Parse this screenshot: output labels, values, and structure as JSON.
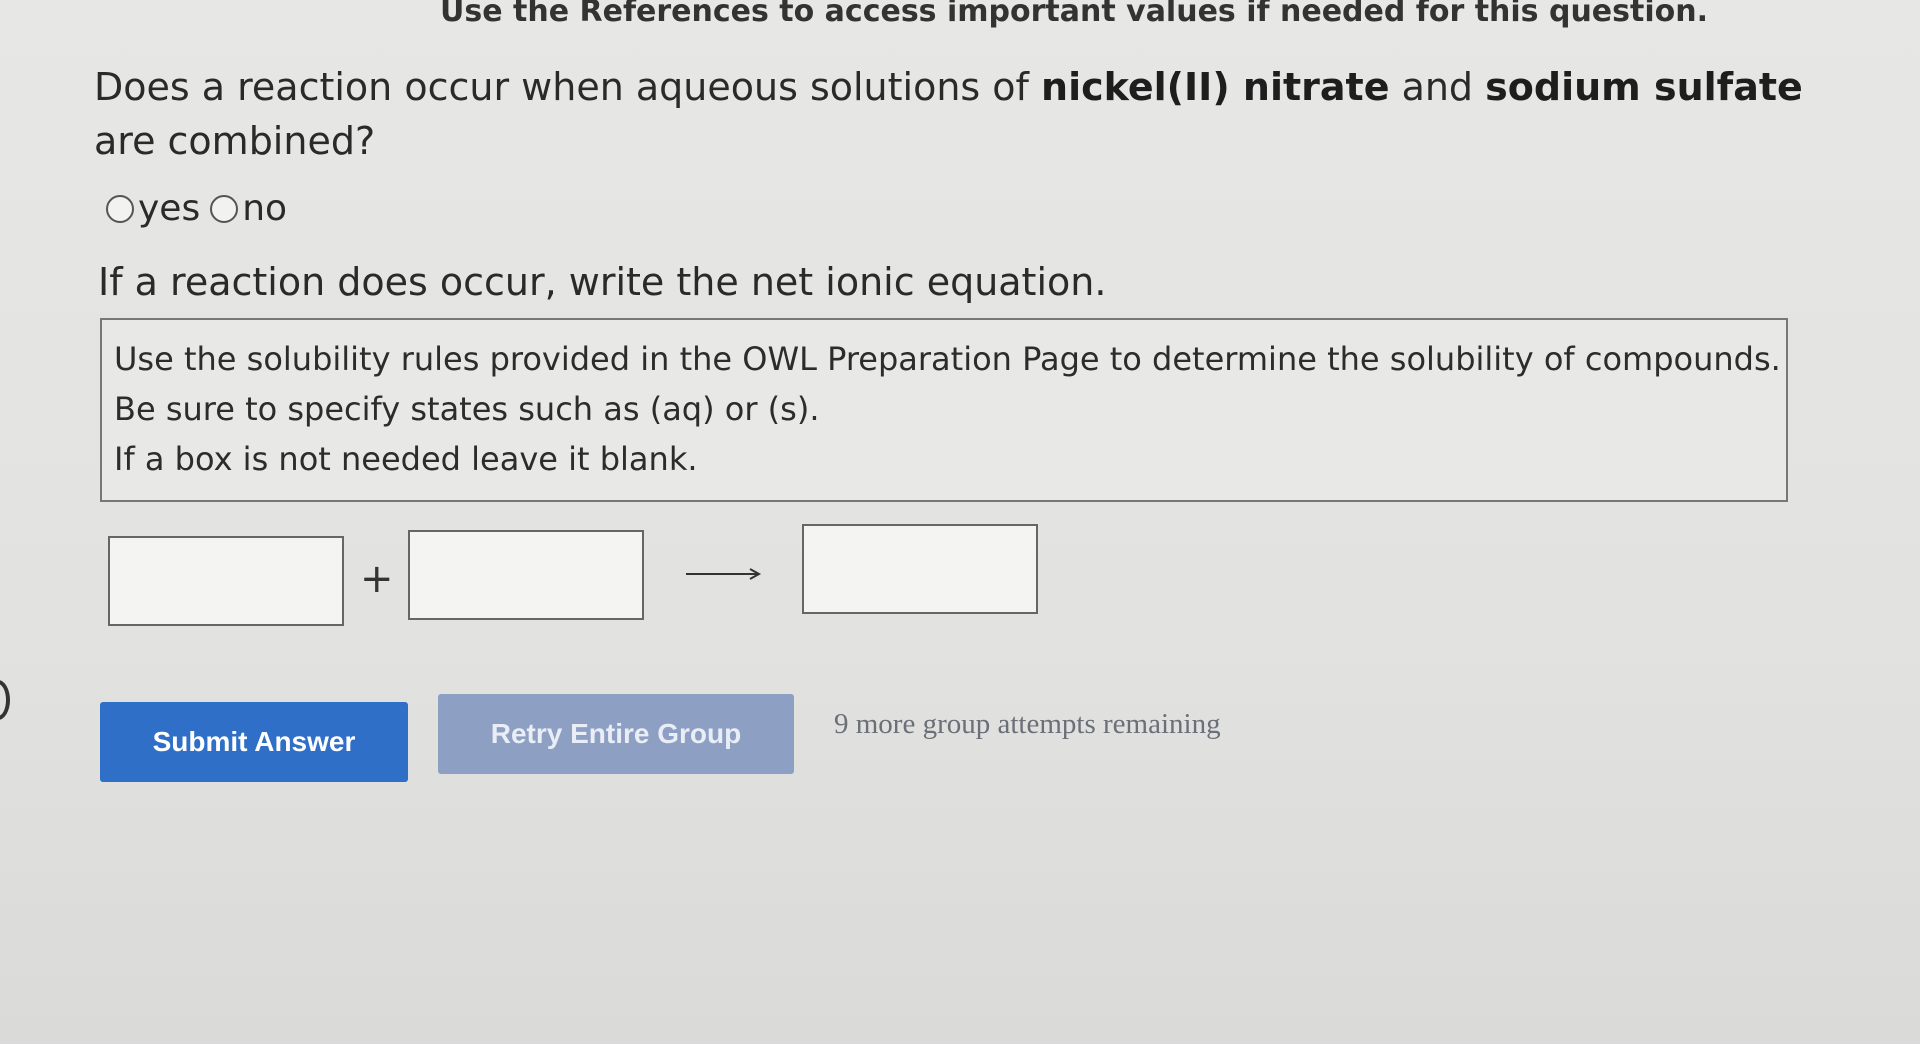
{
  "header": {
    "references_text": "Use the References to access important values if needed for this question."
  },
  "question": {
    "prefix": "Does a reaction occur when aqueous solutions of ",
    "reactant1": "nickel(II) nitrate",
    "middle": " and ",
    "reactant2": "sodium sulfate",
    "suffix": " are combined?"
  },
  "options": {
    "yes": "yes",
    "no": "no"
  },
  "instruction": "If a reaction does occur, write the net ionic equation.",
  "hints": {
    "line1": "Use the solubility rules provided in the OWL Preparation Page to determine the solubility of compounds.",
    "line2": "Be sure to specify states such as (aq) or (s).",
    "line3": "If a box is not needed leave it blank."
  },
  "equation": {
    "plus": "+",
    "input1_value": "",
    "input2_value": "",
    "product_value": ""
  },
  "buttons": {
    "submit": "Submit Answer",
    "retry": "Retry Entire Group"
  },
  "attempts_text": "9 more group attempts remaining",
  "colors": {
    "submit_bg": "#2f6fc7",
    "retry_bg": "#8e9fc4",
    "attempts_text": "#6a6f78"
  }
}
